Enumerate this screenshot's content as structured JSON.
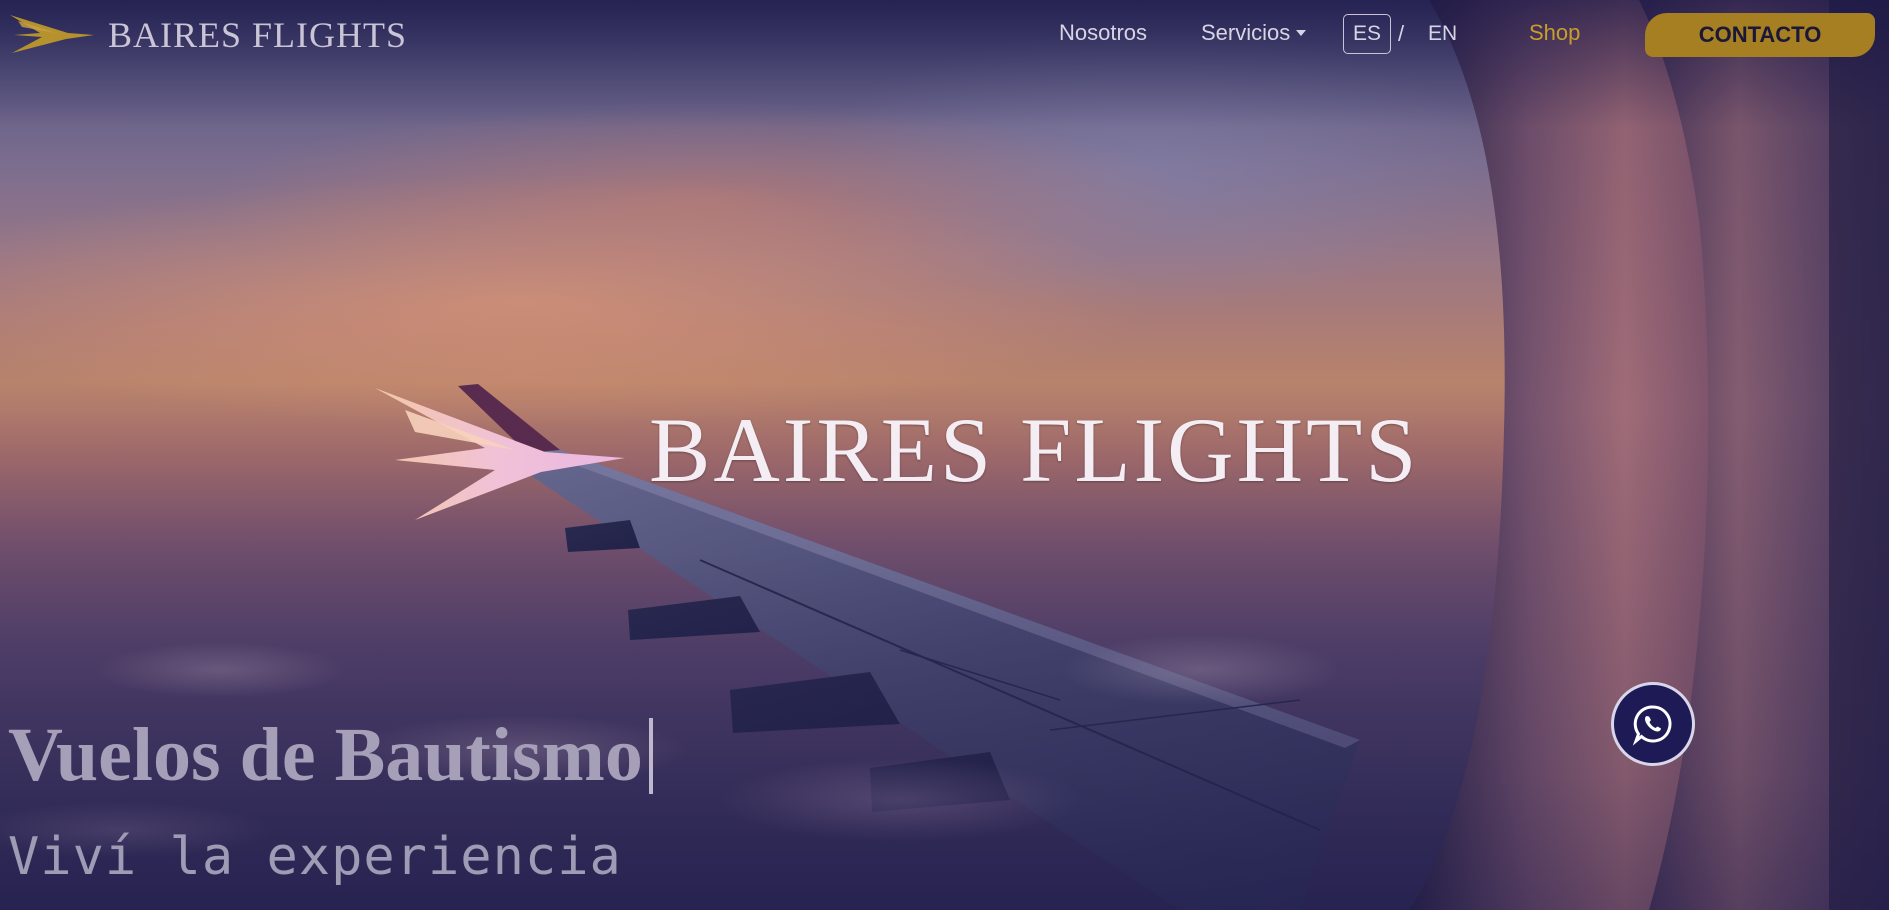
{
  "header": {
    "logo_text": "BAIRES FLIGHTS",
    "nav": {
      "nosotros": "Nosotros",
      "servicios": "Servicios",
      "shop": "Shop",
      "contact": "CONTACTO"
    },
    "language": {
      "es": "ES",
      "separator": "/",
      "en": "EN",
      "selected": "ES"
    }
  },
  "hero": {
    "brand_title": "BAIRES FLIGHTS",
    "headline": "Vuelos de Bautismo",
    "subheadline": "Viví la experiencia"
  },
  "icons": {
    "logo": "logo-mark-icon",
    "servicios_caret": "caret-down-icon",
    "whatsapp": "whatsapp-icon"
  },
  "colors": {
    "accent_gold": "#a57f22",
    "shop_gold": "#c99d2c",
    "overlay_navy": "#1d1a55",
    "nav_text": "#d7d4e4"
  }
}
